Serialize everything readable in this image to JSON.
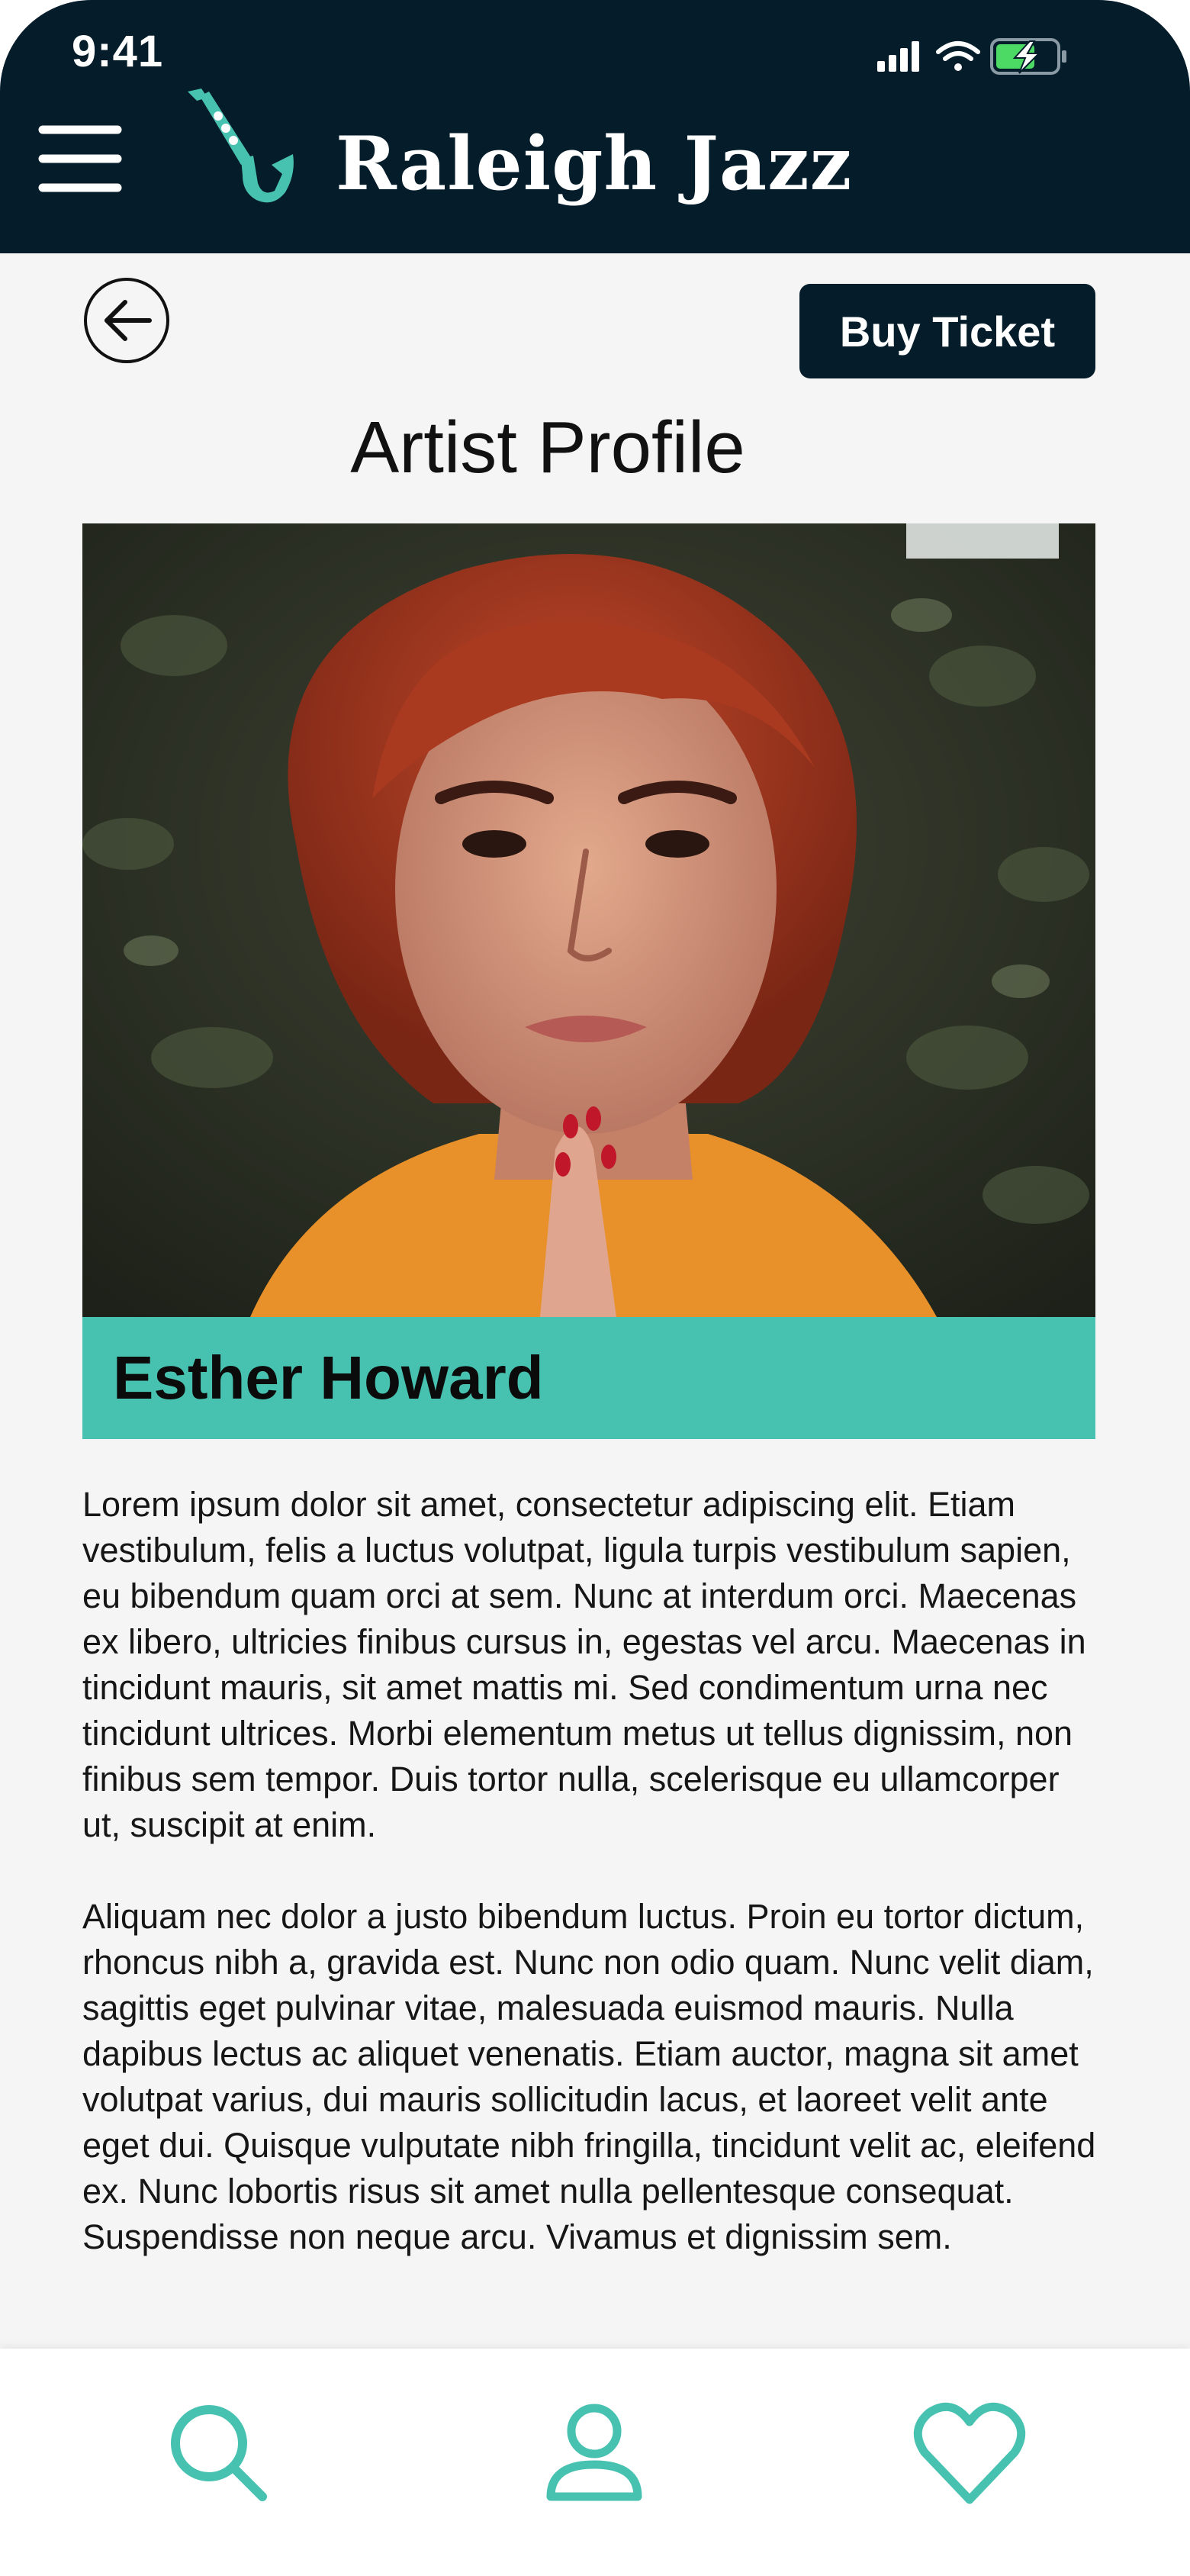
{
  "status_bar": {
    "time": "9:41"
  },
  "header": {
    "app_name": "Raleigh Jazz",
    "background_color": "#051d2b",
    "icons": [
      "menu-icon",
      "saxophone-logo-icon"
    ]
  },
  "toolbar": {
    "back_icon": "arrow-left-icon",
    "buy_label": "Buy Ticket"
  },
  "page": {
    "title": "Artist Profile"
  },
  "artist": {
    "name": "Esther Howard",
    "name_bar_color": "#48c2b0",
    "bio": [
      "Lorem ipsum dolor sit amet, consectetur adipiscing elit. Etiam vestibulum, felis a luctus volutpat, ligula turpis vestibulum sapien, eu bibendum quam orci at sem. Nunc at interdum orci. Maecenas ex libero, ultricies finibus cursus in, egestas vel arcu. Maecenas in tincidunt mauris, sit amet mattis mi. Sed condimentum urna nec tincidunt ultrices. Morbi elementum metus ut tellus dignissim, non finibus sem tempor. Duis tortor nulla, scelerisque eu ullamcorper ut, suscipit at enim.",
      "Aliquam nec dolor a justo bibendum luctus. Proin eu tortor dictum, rhoncus nibh a, gravida est. Nunc non odio quam. Nunc velit diam, sagittis eget pulvinar vitae, malesuada euismod mauris. Nulla dapibus lectus ac aliquet venenatis. Etiam auctor, magna sit amet volutpat varius, dui mauris sollicitudin lacus, et laoreet velit ante eget dui. Quisque vulputate nibh fringilla, tincidunt velit ac, eleifend ex. Nunc lobortis risus sit amet nulla pellentesque consequat. Suspendisse non neque arcu. Vivamus et dignissim sem."
    ]
  },
  "bottom_nav": {
    "accent_color": "#48c2b0",
    "items": [
      "search-icon",
      "profile-icon",
      "heart-icon"
    ]
  }
}
